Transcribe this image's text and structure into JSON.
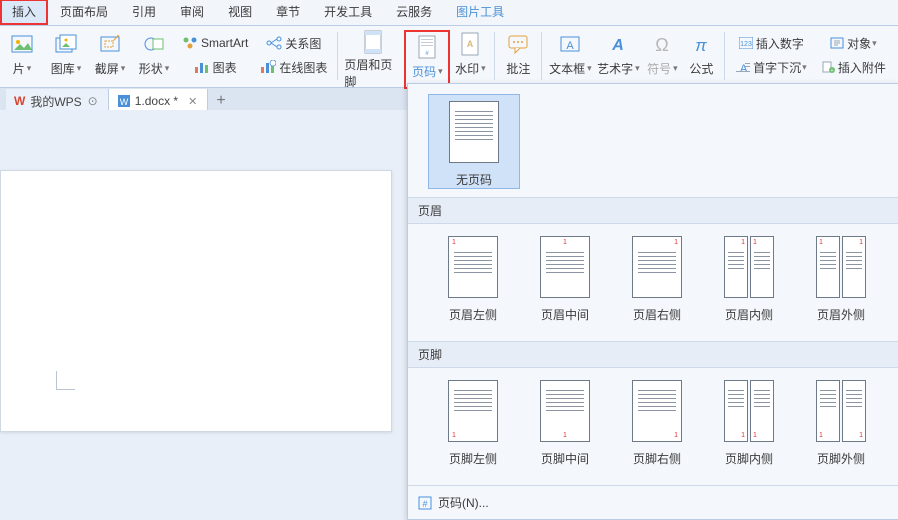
{
  "menu": {
    "tabs": [
      {
        "label": "插入",
        "active": true,
        "highlight": true
      },
      {
        "label": "页面布局"
      },
      {
        "label": "引用"
      },
      {
        "label": "审阅"
      },
      {
        "label": "视图"
      },
      {
        "label": "章节"
      },
      {
        "label": "开发工具"
      },
      {
        "label": "云服务"
      },
      {
        "label": "图片工具",
        "context": true
      }
    ]
  },
  "ribbon": {
    "pic": "片",
    "gallery": "图库",
    "screenshot": "截屏",
    "shape": "形状",
    "relation": "关系图",
    "onlinechart": "在线图表",
    "smartart": "SmartArt",
    "chart": "图表",
    "headerfooter": "页眉和页脚",
    "pagenum": "页码",
    "watermark": "水印",
    "comment": "批注",
    "textbox": "文本框",
    "wordart": "艺术字",
    "symbol": "符号",
    "formula": "公式",
    "insertnum": "插入数字",
    "object": "对象",
    "dropcap": "首字下沉",
    "attach": "插入附件"
  },
  "doctabs": {
    "wps": "我的WPS",
    "doc": "1.docx *"
  },
  "panel": {
    "none": "无页码",
    "header": {
      "title": "页眉",
      "items": [
        "页眉左侧",
        "页眉中间",
        "页眉右侧",
        "页眉内侧",
        "页眉外侧"
      ]
    },
    "footer": {
      "title": "页脚",
      "items": [
        "页脚左侧",
        "页脚中间",
        "页脚右侧",
        "页脚内侧",
        "页脚外侧"
      ]
    },
    "more": "页码(N)..."
  }
}
